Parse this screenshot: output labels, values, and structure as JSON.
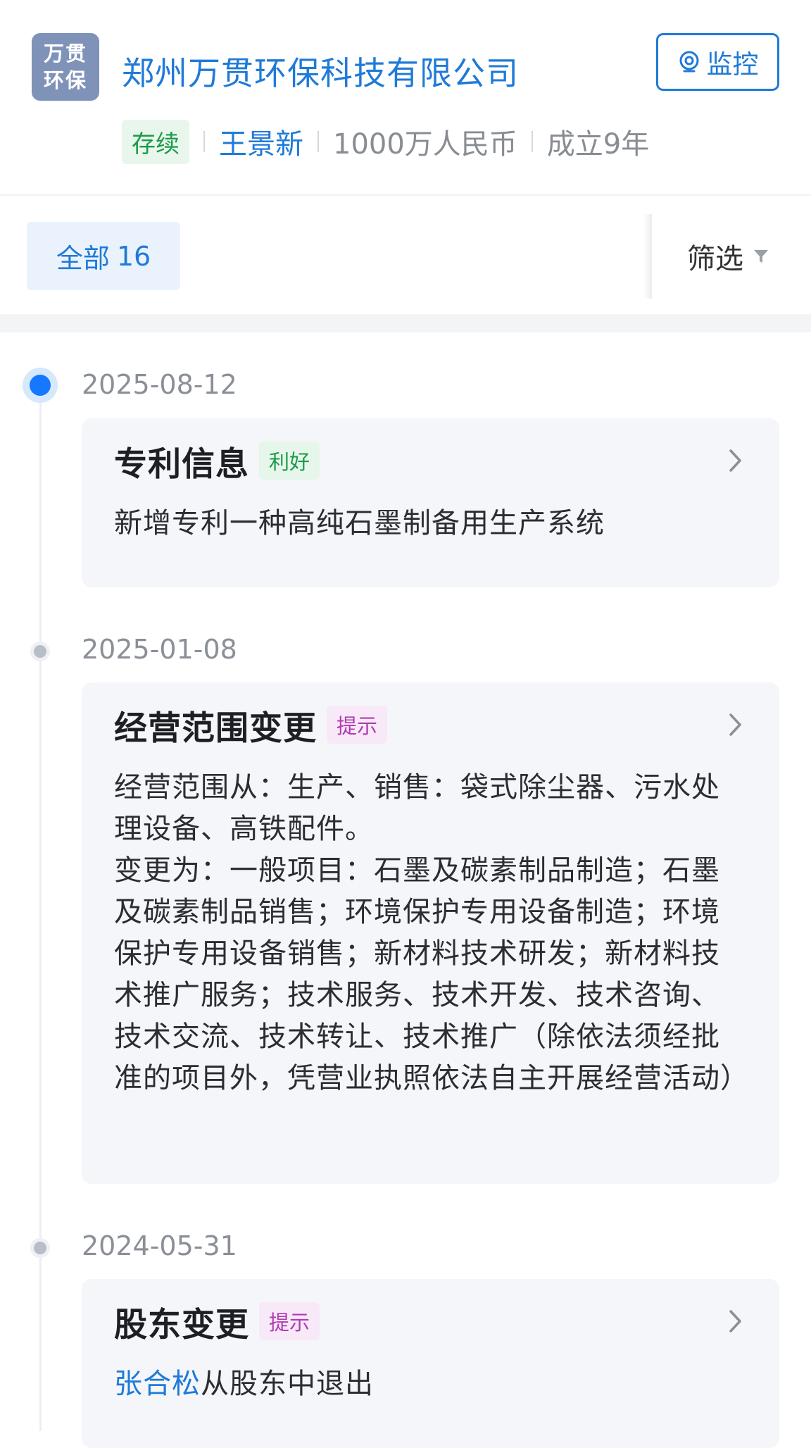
{
  "company": {
    "logo_line1": "万贯",
    "logo_line2": "环保",
    "name": "郑州万贯环保科技有限公司",
    "monitor_label": "监控",
    "status": "存续",
    "legal_rep": "王景新",
    "capital": "1000万人民币",
    "established": "成立9年"
  },
  "filter": {
    "all_label": "全部",
    "all_count": "16",
    "filter_label": "筛选"
  },
  "timeline": [
    {
      "date": "2025-08-12",
      "title": "专利信息",
      "tag": "利好",
      "body": "新增专利一种高纯石墨制备用生产系统"
    },
    {
      "date": "2025-01-08",
      "title": "经营范围变更",
      "tag": "提示",
      "body_line1": "经营范围从：生产、销售：袋式除尘器、污水处理设备、高铁配件。",
      "body_line2": "变更为：一般项目：石墨及碳素制品制造；石墨及碳素制品销售；环境保护专用设备制造；环境保护专用设备销售；新材料技术研发；新材料技术推广服务；技术服务、技术开发、技术咨询、技术交流、技术转让、技术推广（除依法须经批准的项目外，凭营业执照依法自主开展经营活动）"
    },
    {
      "date": "2024-05-31",
      "title": "股东变更",
      "tag": "提示",
      "person": "张合松",
      "body_suffix": "从股东中退出"
    }
  ]
}
